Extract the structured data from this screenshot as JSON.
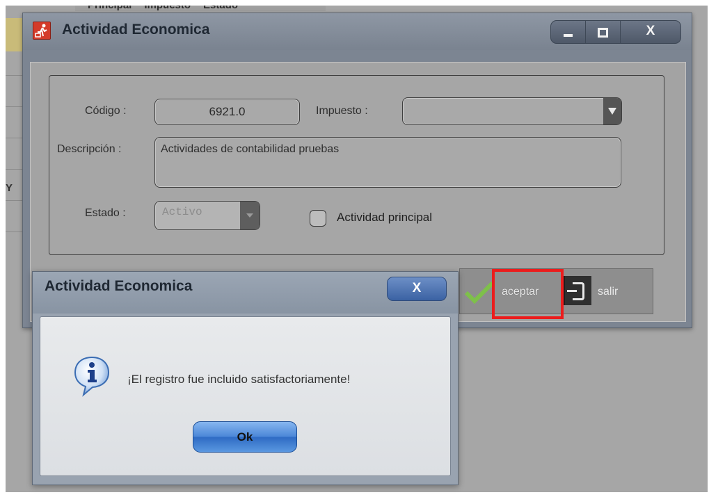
{
  "background": {
    "tabs": [
      "Principal",
      "Impuesto",
      "Estado"
    ],
    "partial_text": "Y"
  },
  "window": {
    "title": "Actividad Economica",
    "icon": "app-icon",
    "controls": {
      "minimize": "minimize-icon",
      "maximize": "maximize-icon",
      "close_label": "X"
    }
  },
  "form": {
    "codigo_label": "Código :",
    "codigo_value": "6921.0",
    "impuesto_label": "Impuesto :",
    "impuesto_value": "",
    "descripcion_label": "Descripción :",
    "descripcion_value": "Actividades de contabilidad pruebas",
    "estado_label": "Estado :",
    "estado_value": "Activo",
    "actividad_principal_label": "Actividad principal",
    "actividad_principal_checked": false
  },
  "buttons": {
    "aceptar": "aceptar",
    "salir": "salir"
  },
  "highlight_color": "#ec1c1c",
  "dialog": {
    "title": "Actividad Economica",
    "close_label": "X",
    "message": "¡El registro fue incluido satisfactoriamente!",
    "ok_label": "Ok",
    "icon": "info-icon"
  }
}
